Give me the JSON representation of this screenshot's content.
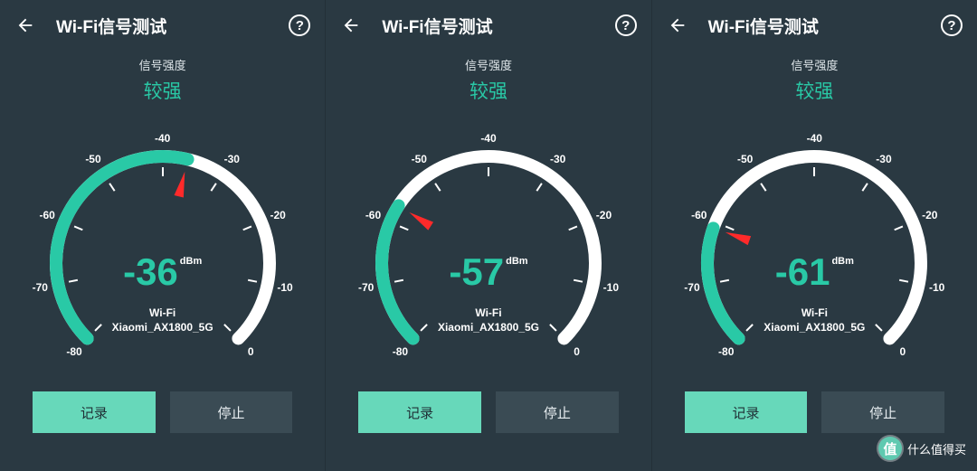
{
  "common": {
    "title": "Wi-Fi信号测试",
    "help_glyph": "?",
    "signal_strength_label": "信号强度",
    "rating_text": "较强",
    "unit": "dBm",
    "net_label": "Wi-Fi",
    "ssid": "Xiaomi_AX1800_5G",
    "record_btn": "记录",
    "stop_btn": "停止",
    "tick_labels": [
      "-80",
      "-70",
      "-60",
      "-50",
      "-40",
      "-30",
      "-20",
      "-10",
      "0"
    ]
  },
  "panels": [
    {
      "value": "-36",
      "value_num": -36
    },
    {
      "value": "-57",
      "value_num": -57
    },
    {
      "value": "-61",
      "value_num": -61
    }
  ],
  "colors": {
    "accent": "#29c9a6",
    "needle": "#ff2a2a",
    "track": "#ffffff",
    "panel": "#2a3942",
    "btn_primary": "#67d8ba",
    "btn_secondary": "#3a4b54"
  },
  "watermark": {
    "badge": "值",
    "text": "什么值得买"
  },
  "chart_data": [
    {
      "type": "gauge",
      "title": "Wi-Fi信号测试",
      "value": -36,
      "unit": "dBm",
      "range": [
        -80,
        0
      ],
      "ticks": [
        -80,
        -70,
        -60,
        -50,
        -40,
        -30,
        -20,
        -10,
        0
      ],
      "label": "较强",
      "series_label": "Xiaomi_AX1800_5G"
    },
    {
      "type": "gauge",
      "title": "Wi-Fi信号测试",
      "value": -57,
      "unit": "dBm",
      "range": [
        -80,
        0
      ],
      "ticks": [
        -80,
        -70,
        -60,
        -50,
        -40,
        -30,
        -20,
        -10,
        0
      ],
      "label": "较强",
      "series_label": "Xiaomi_AX1800_5G"
    },
    {
      "type": "gauge",
      "title": "Wi-Fi信号测试",
      "value": -61,
      "unit": "dBm",
      "range": [
        -80,
        0
      ],
      "ticks": [
        -80,
        -70,
        -60,
        -50,
        -40,
        -30,
        -20,
        -10,
        0
      ],
      "label": "较强",
      "series_label": "Xiaomi_AX1800_5G"
    }
  ]
}
